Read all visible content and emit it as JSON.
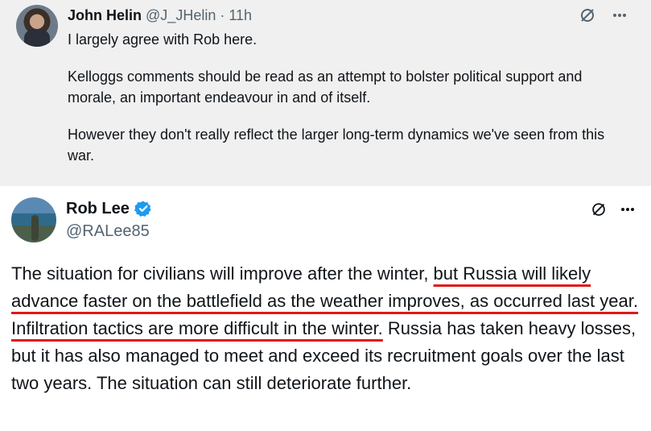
{
  "reply": {
    "name": "John Helin",
    "handle": "@J_JHelin",
    "separator": "·",
    "time": "11h",
    "paragraphs": [
      "I largely agree with Rob here.",
      "Kelloggs comments should be read as an attempt to bolster political support and morale, an important endeavour in and of itself.",
      "However they don't really reflect the larger long-term dynamics we've seen from this war."
    ]
  },
  "main": {
    "name": "Rob Lee",
    "handle": "@RALee85",
    "text_before": "The situation for civilians will improve after the winter, ",
    "highlight": "but Russia will likely advance faster on the battlefield as the weather improves, as occurred last year. Infiltration tactics are more difficult in the winter.",
    "text_after": " Russia has taken heavy losses, but it has also managed to meet and exceed its recruitment goals over the last two years. The situation can still deteriorate further."
  },
  "colors": {
    "reply_bg": "#f0f0f0",
    "verified_blue": "#1d9bf0",
    "underline_red": "#e01818",
    "text_primary": "#0f1419",
    "text_secondary": "#536471"
  },
  "icons": {
    "reply_grok": "slash-circle-icon",
    "reply_more": "more-icon",
    "main_grok": "slash-circle-icon",
    "main_more": "more-icon",
    "verified": "verified-badge-icon"
  }
}
